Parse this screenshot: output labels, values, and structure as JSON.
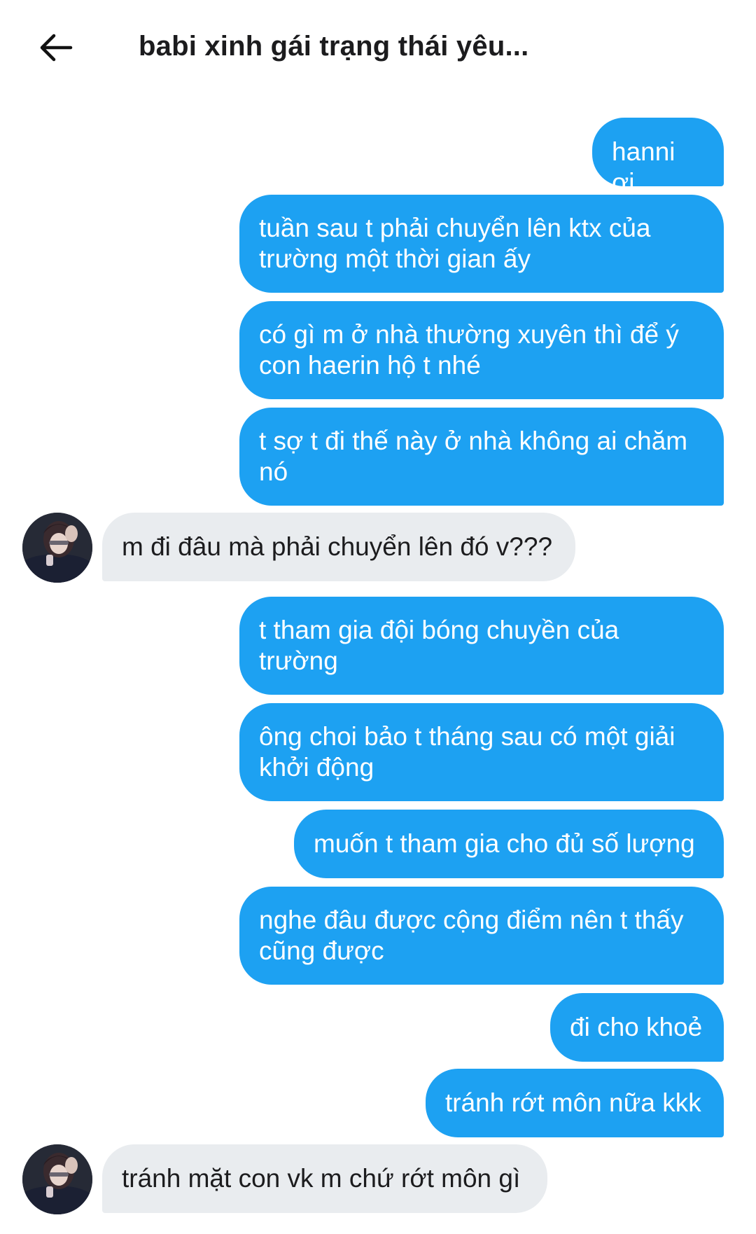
{
  "header": {
    "back_icon": "arrow-left-icon",
    "title": "babi xinh gái trạng thái yêu..."
  },
  "colors": {
    "sent_bubble": "#1da1f2",
    "received_bubble": "#e9ecef"
  },
  "messages": [
    {
      "from": "me",
      "text": "hanni ơi"
    },
    {
      "from": "me",
      "text": "tuần sau t phải chuyển lên ktx của trường một thời gian ấy"
    },
    {
      "from": "me",
      "text": "có gì m ở nhà thường xuyên thì để ý con haerin hộ t nhé"
    },
    {
      "from": "me",
      "text": "t sợ t đi thế này ở nhà không ai chăm nó"
    },
    {
      "from": "them",
      "text": "m đi đâu mà phải chuyển lên đó v???"
    },
    {
      "from": "me",
      "text": "t tham gia đội bóng chuyền của trường"
    },
    {
      "from": "me",
      "text": "ông choi bảo t tháng sau có một giải khởi động"
    },
    {
      "from": "me",
      "text": "muốn t tham gia cho đủ số lượng"
    },
    {
      "from": "me",
      "text": "nghe đâu được cộng điểm nên t thấy cũng được"
    },
    {
      "from": "me",
      "text": "đi cho khoẻ"
    },
    {
      "from": "me",
      "text": "tránh rớt môn nữa kkk"
    },
    {
      "from": "them",
      "text": "tránh mặt con vk m chứ rớt môn gì"
    }
  ]
}
